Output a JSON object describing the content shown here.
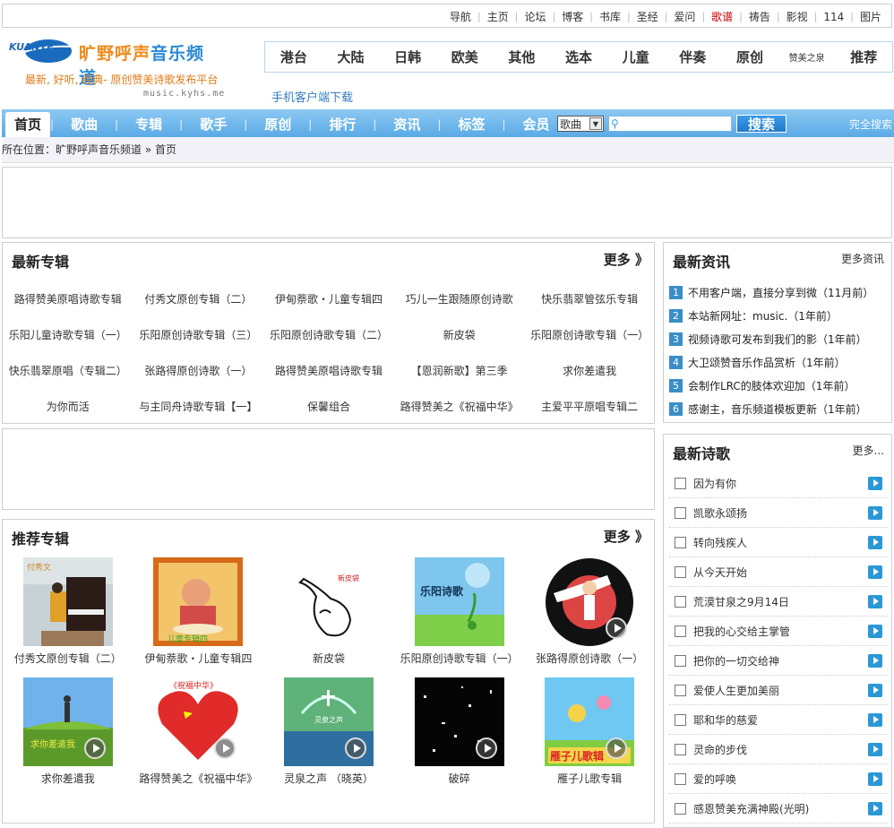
{
  "top_links": [
    {
      "label": "导航"
    },
    {
      "label": "主页"
    },
    {
      "label": "论坛"
    },
    {
      "label": "博客"
    },
    {
      "label": "书库"
    },
    {
      "label": "圣经"
    },
    {
      "label": "爱问"
    },
    {
      "label": "歌谱",
      "highlight": true
    },
    {
      "label": "祷告"
    },
    {
      "label": "影视"
    },
    {
      "label": "114"
    },
    {
      "label": "图片"
    }
  ],
  "logo": {
    "mark_text": "KUANYE",
    "title_part1": "旷野呼声",
    "title_part2": "音乐频道",
    "slogan": "最新, 好听, 经典- 原创赞美诗歌发布平台",
    "url": "music.kyhs.me"
  },
  "categories": [
    "港台",
    "大陆",
    "日韩",
    "欧美",
    "其他",
    "选本",
    "儿童",
    "伴奏",
    "原创",
    "赞美之泉",
    "推荐"
  ],
  "mobile_link": "手机客户端下载",
  "main_nav": [
    "首页",
    "歌曲",
    "专辑",
    "歌手",
    "原创",
    "排行",
    "资讯",
    "标签",
    "会员"
  ],
  "search": {
    "select_value": "歌曲",
    "button_label": "搜索",
    "full_search": "完全搜索"
  },
  "breadcrumb": {
    "prefix": "所在位置：",
    "site": "旷野呼声音乐频道",
    "sep": "»",
    "current": "首页"
  },
  "latest_albums": {
    "title": "最新专辑",
    "more": "更多 》",
    "rows": [
      [
        "路得赞美原唱诗歌专辑",
        "付秀文原创专辑（二）",
        "伊甸萘歌・儿童专辑四",
        "巧儿一生跟随原创诗歌",
        "快乐翡翠管弦乐专辑"
      ],
      [
        "乐阳儿童诗歌专辑（一）",
        "乐阳原创诗歌专辑（三）",
        "乐阳原创诗歌专辑（二）",
        "新皮袋",
        "乐阳原创诗歌专辑（一）"
      ],
      [
        "快乐翡翠原唱（专辑二）",
        "张路得原创诗歌（一）",
        "路得赞美原唱诗歌专辑",
        "【恩润新歌】第三季",
        "求你差遣我"
      ],
      [
        "为你而活",
        "与主同舟诗歌专辑【一】",
        "保馨组合",
        "路得赞美之《祝福中华》",
        "主爱平平原唱专辑二"
      ]
    ]
  },
  "latest_news": {
    "title": "最新资讯",
    "more": "更多资讯",
    "items": [
      {
        "num": "1",
        "text": "不用客户端，直接分享到微（11月前）"
      },
      {
        "num": "2",
        "text": "本站新网址：music.（1年前）"
      },
      {
        "num": "3",
        "text": "视频诗歌可发布到我们的影（1年前）"
      },
      {
        "num": "4",
        "text": "大卫颂赞音乐作品赏析（1年前）"
      },
      {
        "num": "5",
        "text": "会制作LRC的肢体欢迎加（1年前）"
      },
      {
        "num": "6",
        "text": "感谢主，音乐频道模板更新（1年前）"
      }
    ]
  },
  "recommended": {
    "title": "推荐专辑",
    "more": "更多 》",
    "rows": [
      [
        {
          "caption": "付秀文原创专辑（二）",
          "art": "piano"
        },
        {
          "caption": "伊甸萘歌・儿童专辑四",
          "art": "child"
        },
        {
          "caption": "新皮袋",
          "art": "wineskin"
        },
        {
          "caption": "乐阳原创诗歌专辑（一）",
          "art": "leyang"
        },
        {
          "caption": "张路得原创诗歌（一）",
          "art": "singer"
        }
      ],
      [
        {
          "caption": "求你差遣我",
          "art": "hill"
        },
        {
          "caption": "路得赞美之《祝福中华》",
          "art": "heart"
        },
        {
          "caption": "灵泉之声 （晓英）",
          "art": "spring"
        },
        {
          "caption": "破碎",
          "art": "broken"
        },
        {
          "caption": "雁子儿歌专辑",
          "art": "kids"
        }
      ]
    ]
  },
  "latest_poems": {
    "title": "最新诗歌",
    "more": "更多...",
    "items": [
      "因为有你",
      "凯歌永颂扬",
      "转向残疾人",
      "从今天开始",
      "荒漠甘泉之9月14日",
      "把我的心交给主掌管",
      "把你的一切交给神",
      "爱使人生更加美丽",
      "耶和华的慈爱",
      "灵命的步伐",
      "爱的呼唤",
      "感恩赞美充满神殿(光明)"
    ]
  },
  "colors": {
    "nav_blue": "#5aaae6",
    "accent_orange": "#e07b17",
    "link_red": "#c00000",
    "badge_blue": "#3a8ec8"
  }
}
